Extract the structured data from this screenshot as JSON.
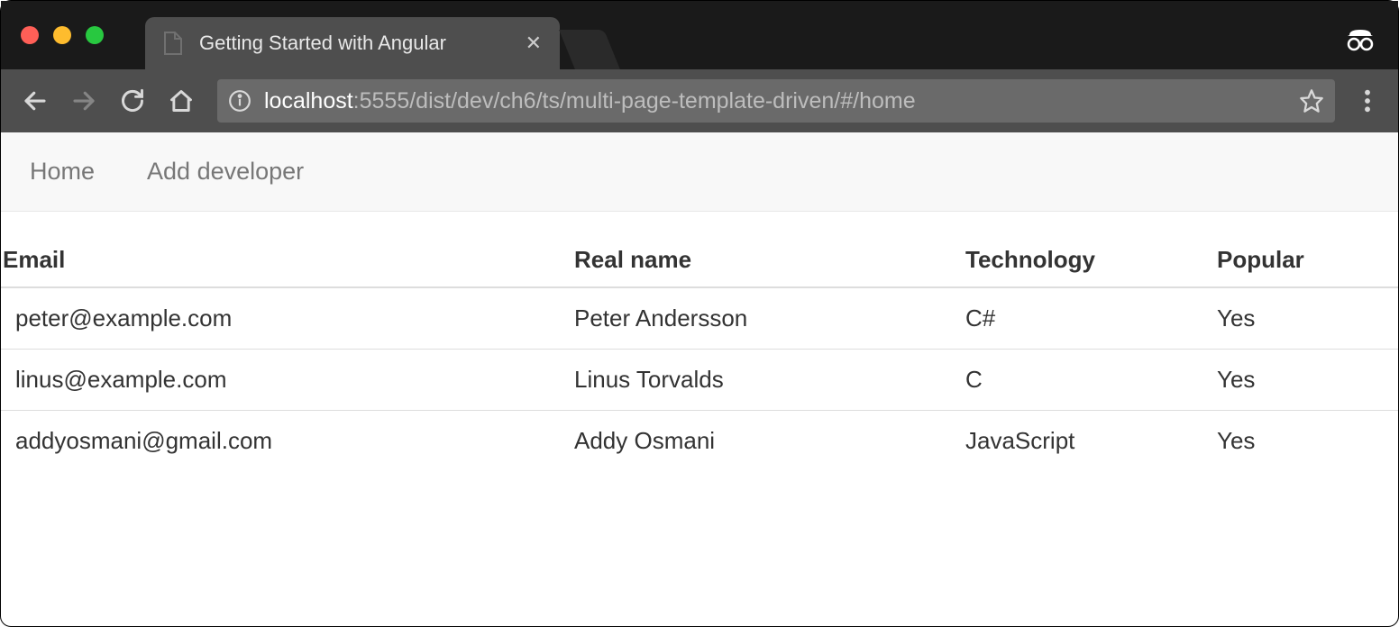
{
  "browser": {
    "tab_title": "Getting Started with Angular",
    "url_host": "localhost",
    "url_path": ":5555/dist/dev/ch6/ts/multi-page-template-driven/#/home"
  },
  "nav": {
    "home": "Home",
    "add_dev": "Add developer"
  },
  "table": {
    "headers": {
      "email": "Email",
      "name": "Real name",
      "tech": "Technology",
      "popular": "Popular"
    },
    "rows": [
      {
        "email": "peter@example.com",
        "name": "Peter Andersson",
        "tech": "C#",
        "popular": "Yes"
      },
      {
        "email": "linus@example.com",
        "name": "Linus Torvalds",
        "tech": "C",
        "popular": "Yes"
      },
      {
        "email": "addyosmani@gmail.com",
        "name": "Addy Osmani",
        "tech": "JavaScript",
        "popular": "Yes"
      }
    ]
  }
}
